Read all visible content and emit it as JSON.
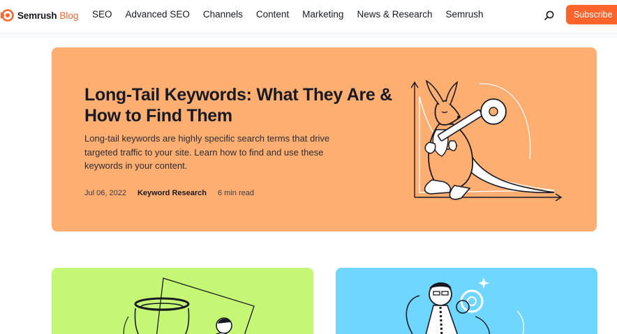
{
  "brand": {
    "name": "Semrush",
    "section": "Blog",
    "accent": "#ff642d"
  },
  "nav": {
    "items": [
      {
        "label": "SEO"
      },
      {
        "label": "Advanced SEO"
      },
      {
        "label": "Channels"
      },
      {
        "label": "Content"
      },
      {
        "label": "Marketing"
      },
      {
        "label": "News & Research"
      },
      {
        "label": "Semrush"
      }
    ],
    "search_icon": "search-icon",
    "subscribe_label": "Subscribe"
  },
  "featured": {
    "title": "Long-Tail Keywords: What They Are & How to Find Them",
    "description": "Long-tail keywords are highly specific search terms that drive targeted traffic to your site. Learn how to find and use these keywords in your content.",
    "date": "Jul 06, 2022",
    "category": "Keyword Research",
    "read_time": "6 min read",
    "background": "#ffae72",
    "illustration": "kangaroo-holding-key-on-chart"
  },
  "cards": [
    {
      "background": "#c5f774",
      "illustration": "hoop-and-figure"
    },
    {
      "background": "#6fd6ff",
      "illustration": "person-with-gears"
    }
  ]
}
